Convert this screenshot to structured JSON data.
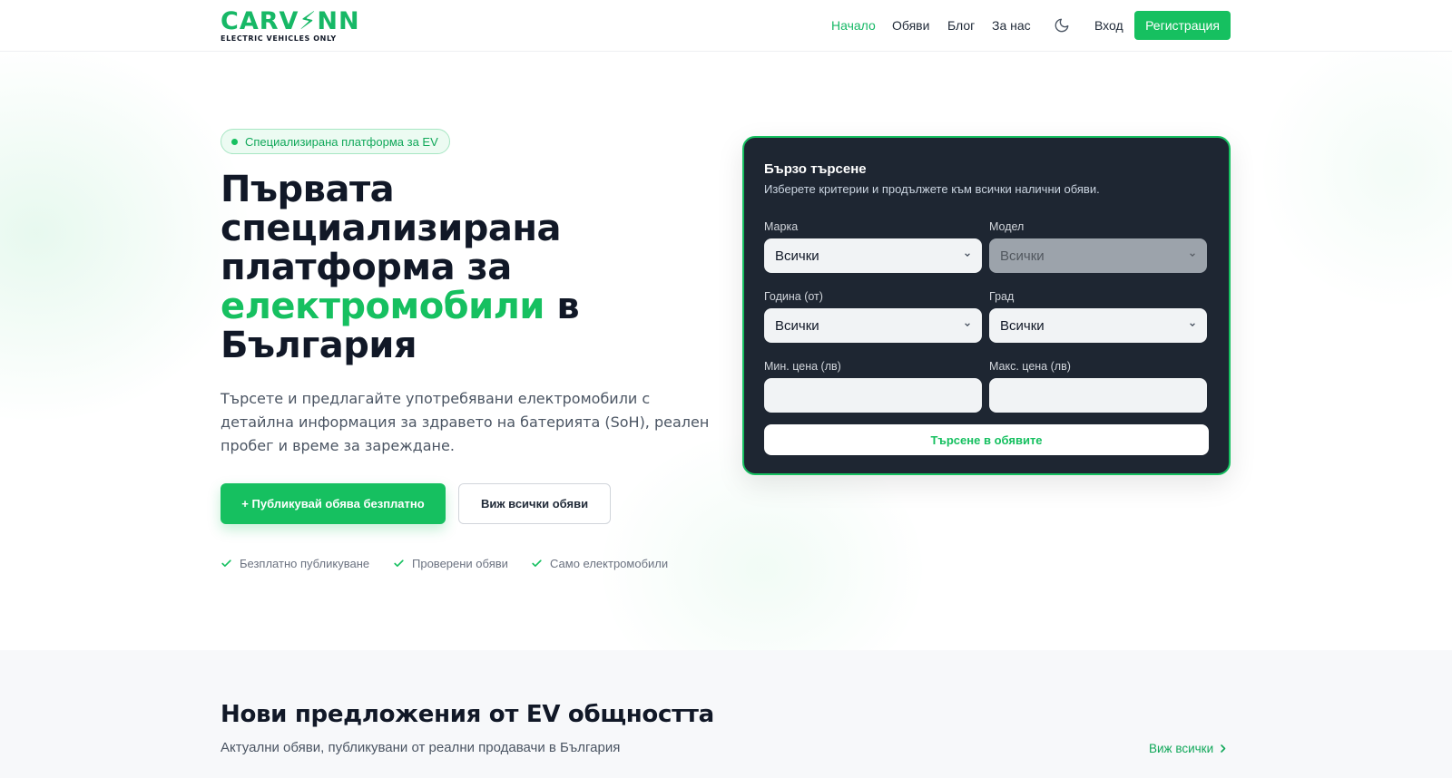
{
  "brand": {
    "logo_main": "CARV",
    "logo_bolt": "⚡",
    "logo_end": "NN",
    "logo_tagline": "ELECTRIC VEHICLES ONLY",
    "accent_color": "#16c060"
  },
  "nav": {
    "home": "Начало",
    "listings": "Обяви",
    "blog": "Блог",
    "about": "За нас",
    "theme_icon": "moon-icon",
    "login": "Вход",
    "register": "Регистрация"
  },
  "hero": {
    "badge": "Специализирана платформа за EV",
    "title_line1": "Първата",
    "title_line2": "специализирана",
    "title_line3": "платформа за",
    "title_highlight": "електромобили",
    "title_after_highlight": " в",
    "title_line5": "България",
    "lead": "Търсете и предлагайте употребявани електромобили с детайлна информация за здравето на батерията (SoH), реален пробег и време за зареждане.",
    "cta_primary": "+ Публикувай обява безплатно",
    "cta_secondary": "Виж всички обяви",
    "features": [
      "Безплатно публикуване",
      "Проверени обяви",
      "Само електромобили"
    ]
  },
  "search": {
    "title": "Бързо търсене",
    "subtitle": "Изберете критерии и продължете към всички налични обяви.",
    "make_label": "Марка",
    "make_value": "Всички",
    "model_label": "Модел",
    "model_value": "Всички",
    "year_label": "Година (от)",
    "year_value": "Всички",
    "city_label": "Град",
    "city_value": "Всички",
    "min_price_label": "Мин. цена (лв)",
    "min_price_value": "",
    "max_price_label": "Макс. цена (лв)",
    "max_price_value": "",
    "submit": "Търсене в обявите"
  },
  "latest": {
    "title": "Нови предложения от EV общността",
    "subtitle": "Актуални обяви, публикувани от реални продавачи в България",
    "see_all": "Виж всички"
  }
}
